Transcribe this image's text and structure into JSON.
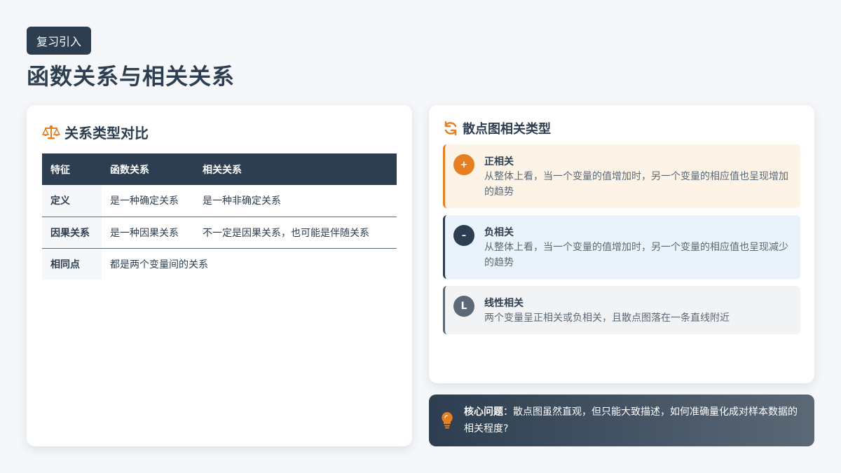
{
  "header": {
    "tag": "复习引入",
    "title": "函数关系与相关关系"
  },
  "compare": {
    "title": "关系类型对比",
    "icon": "scale-icon",
    "columns": [
      "特征",
      "函数关系",
      "相关关系"
    ],
    "rows": [
      {
        "feature": "定义",
        "function": "是一种确定关系",
        "correlation": "是一种非确定关系"
      },
      {
        "feature": "因果关系",
        "function": "是一种因果关系",
        "correlation": "不一定是因果关系，也可能是伴随关系"
      },
      {
        "feature": "相同点",
        "merged": "都是两个变量间的关系"
      }
    ]
  },
  "scatter": {
    "title": "散点图相关类型",
    "icon": "refresh-icon",
    "types": [
      {
        "badge": "+",
        "name": "正相关",
        "desc": "从整体上看，当一个变量的值增加时，另一个变量的相应值也呈现增加的趋势",
        "color": "#e67e22"
      },
      {
        "badge": "–",
        "name": "负相关",
        "desc": "从整体上看，当一个变量的值增加时，另一个变量的相应值也呈现减少的趋势",
        "color": "#2c3e50"
      },
      {
        "badge": "L",
        "name": "线性相关",
        "desc": "两个变量呈正相关或负相关，且散点图落在一条直线附近",
        "color": "#5b6876"
      }
    ]
  },
  "core": {
    "icon": "lightbulb-icon",
    "label": "核心问题",
    "sep": "：",
    "text": "散点图虽然直观，但只能大致描述，如何准确量化成对样本数据的相关程度?"
  },
  "colors": {
    "primary": "#2c3e50",
    "accent": "#e67e22",
    "muted": "#5b6876"
  }
}
